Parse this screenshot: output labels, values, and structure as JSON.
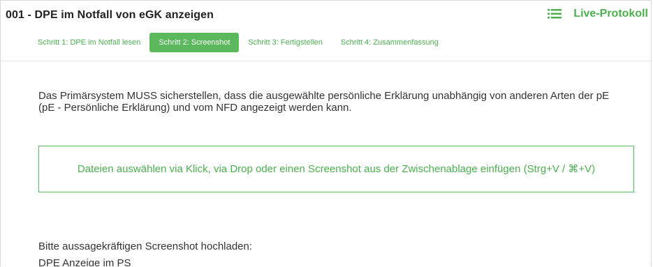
{
  "header": {
    "title": "001 - DPE im Notfall von eGK anzeigen",
    "live_protokoll": {
      "label": "Live-Protokoll",
      "icon": "list-icon"
    }
  },
  "steps": [
    {
      "label": "Schritt 1: DPE im Notfall lesen",
      "active": false
    },
    {
      "label": "Schritt 2: Screenshot",
      "active": true
    },
    {
      "label": "Schritt 3: Fertigstellen",
      "active": false
    },
    {
      "label": "Schritt 4: Zusammenfassung",
      "active": false
    }
  ],
  "main": {
    "instruction": "Das Primärsystem MUSS sicherstellen, dass die ausgewählte persönliche Erklärung unabhängig von anderen Arten der pE (pE - Persönliche Erklärung) und vom NFD angezeigt werden kann.",
    "dropzone_text": "Dateien auswählen via Klick, via Drop oder einen Screenshot aus der Zwischenablage einfügen (Strg+V / ⌘+V)",
    "upload_hint": "Bitte aussagekräftigen Screenshot hochladen:",
    "upload_subject": "DPE Anzeige im PS"
  },
  "colors": {
    "accent": "#5cb85c",
    "accent_text": "#4caf50",
    "text": "#333333"
  }
}
